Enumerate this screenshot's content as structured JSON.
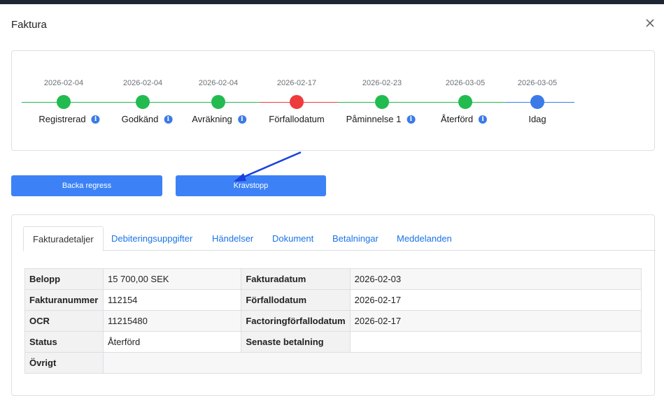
{
  "modal": {
    "title": "Faktura"
  },
  "colors": {
    "green": "#22bb4f",
    "red": "#ee3b3b",
    "blue": "#3b7be8",
    "button": "#3c82f6"
  },
  "timeline": [
    {
      "date": "2026-02-04",
      "label": "Registrerad",
      "status": "done",
      "info": true
    },
    {
      "date": "2026-02-04",
      "label": "Godkänd",
      "status": "done",
      "info": true
    },
    {
      "date": "2026-02-04",
      "label": "Avräkning",
      "status": "done",
      "info": true
    },
    {
      "date": "2026-02-17",
      "label": "Förfallodatum",
      "status": "overdue",
      "info": false
    },
    {
      "date": "2026-02-23",
      "label": "Påminnelse 1",
      "status": "done",
      "info": true
    },
    {
      "date": "2026-03-05",
      "label": "Återförd",
      "status": "done",
      "info": true
    },
    {
      "date": "2026-03-05",
      "label": "Idag",
      "status": "today",
      "info": false
    }
  ],
  "actions": {
    "back_label": "Backa regress",
    "stop_label": "Kravstopp"
  },
  "tabs": [
    {
      "label": "Fakturadetaljer",
      "active": true
    },
    {
      "label": "Debiteringsuppgifter",
      "active": false
    },
    {
      "label": "Händelser",
      "active": false
    },
    {
      "label": "Dokument",
      "active": false
    },
    {
      "label": "Betalningar",
      "active": false
    },
    {
      "label": "Meddelanden",
      "active": false
    }
  ],
  "details": {
    "rows": [
      {
        "k1": "Belopp",
        "v1": "15 700,00 SEK",
        "k2": "Fakturadatum",
        "v2": "2026-02-03"
      },
      {
        "k1": "Fakturanummer",
        "v1": "112154",
        "k2": "Förfallodatum",
        "v2": "2026-02-17"
      },
      {
        "k1": "OCR",
        "v1": "11215480",
        "k2": "Factoringförfallodatum",
        "v2": "2026-02-17"
      },
      {
        "k1": "Status",
        "v1": "Återförd",
        "k2": "Senaste betalning",
        "v2": ""
      },
      {
        "k1": "Övrigt",
        "v1": ""
      }
    ]
  }
}
